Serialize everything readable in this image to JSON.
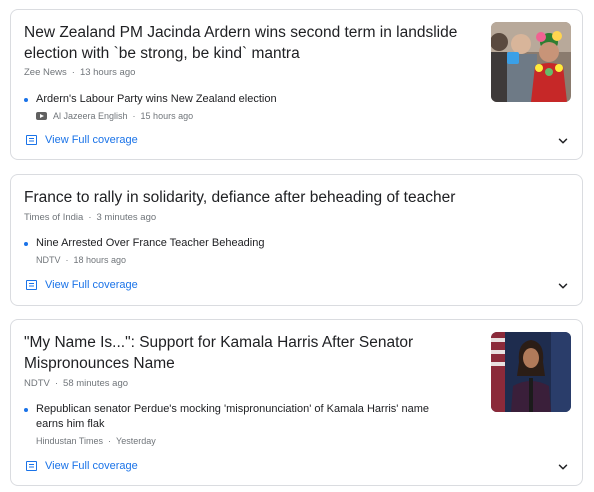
{
  "cards": [
    {
      "headline": "New Zealand PM Jacinda Ardern wins second term in landslide election with `be strong, be kind` mantra",
      "source": "Zee News",
      "time": "13 hours ago",
      "sub_title": "Ardern's Labour Party wins New Zealand election",
      "sub_source": "Al Jazeera English",
      "sub_time": "15 hours ago",
      "sub_has_video_icon": true,
      "coverage_label": "View Full coverage",
      "has_thumbnail": true
    },
    {
      "headline": "France to rally in solidarity, defiance after beheading of teacher",
      "source": "Times of India",
      "time": "3 minutes ago",
      "sub_title": "Nine Arrested Over France Teacher Beheading",
      "sub_source": "NDTV",
      "sub_time": "18 hours ago",
      "coverage_label": "View Full coverage",
      "has_thumbnail": false
    },
    {
      "headline": "\"My Name Is...\": Support for Kamala Harris After Senator Mispronounces Name",
      "source": "NDTV",
      "time": "58 minutes ago",
      "sub_title": "Republican senator Perdue's mocking 'mispronunciation' of Kamala Harris' name earns him flak",
      "sub_source": "Hindustan Times",
      "sub_time": "Yesterday",
      "coverage_label": "View Full coverage",
      "has_thumbnail": true
    }
  ],
  "separator": "·",
  "colors": {
    "link": "#1a73e8",
    "meta": "#70757a",
    "text": "#202124",
    "border": "#dadce0"
  },
  "icons": {
    "coverage": "newspaper-icon",
    "expand": "chevron-down-icon",
    "video": "video-icon"
  }
}
